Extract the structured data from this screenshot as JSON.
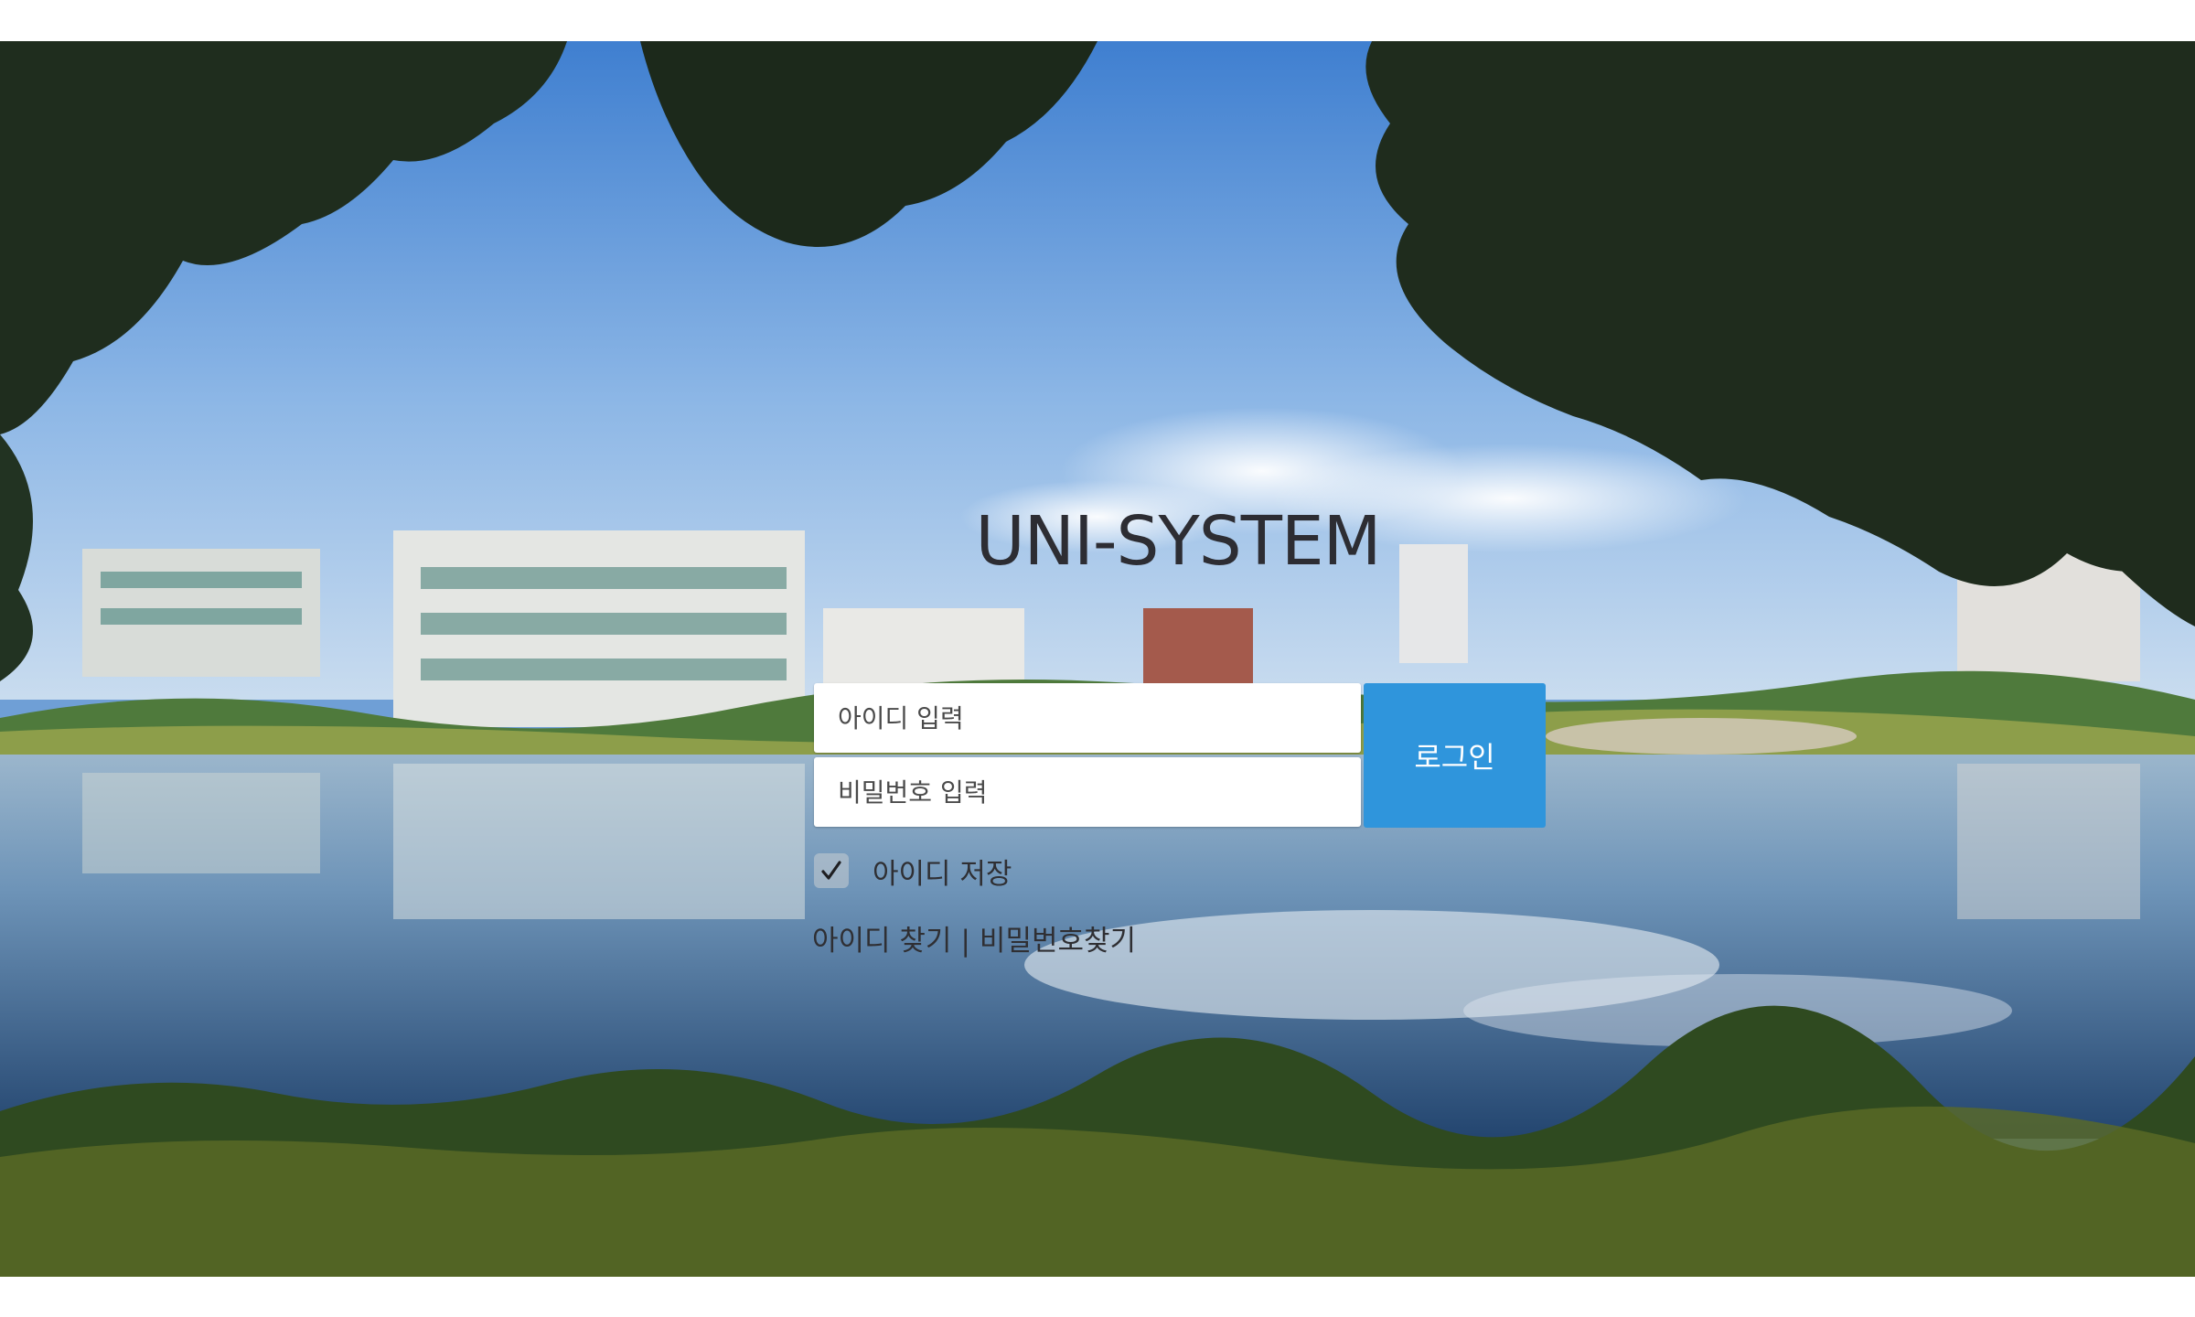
{
  "app": {
    "title": "UNI-SYSTEM"
  },
  "login": {
    "id_placeholder": "아이디 입력",
    "password_placeholder": "비밀번호 입력",
    "submit_label": "로그인",
    "remember_label": "아이디 저장",
    "remember_checked": true,
    "find_id_label": "아이디 찾기",
    "separator": "|",
    "find_password_label": "비밀번호찾기"
  },
  "icons": {
    "checkbox": "check-icon"
  },
  "colors": {
    "accent": "#2f95dc",
    "title_text": "#2d2d33",
    "body_text": "#2f2f33",
    "background": "#ffffff"
  }
}
